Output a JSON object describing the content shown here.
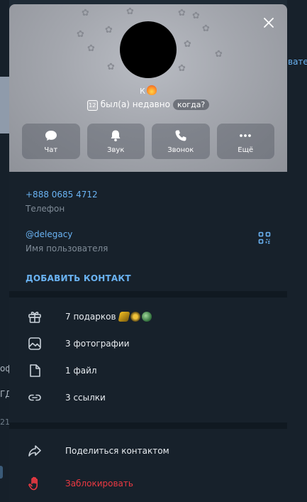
{
  "background": {
    "right_text": "вател",
    "left_texts": [
      "офо",
      "ГД",
      "21:"
    ]
  },
  "hero": {
    "name": "к",
    "last_seen_badge": "12",
    "status": "был(а) недавно",
    "when_chip": "когда?",
    "actions": [
      {
        "label": "Чат",
        "icon": "chat-icon"
      },
      {
        "label": "Звук",
        "icon": "bell-icon"
      },
      {
        "label": "Звонок",
        "icon": "phone-icon"
      },
      {
        "label": "Ещё",
        "icon": "more-icon"
      }
    ]
  },
  "info": {
    "phone": "+888 0685 4712",
    "phone_caption": "Телефон",
    "username": "@delegacy",
    "username_caption": "Имя пользователя",
    "add_contact": "ДОБАВИТЬ КОНТАКТ"
  },
  "media": [
    {
      "label": "7 подарков",
      "icon": "gift-icon"
    },
    {
      "label": "3 фотографии",
      "icon": "photo-icon"
    },
    {
      "label": "1 файл",
      "icon": "file-icon"
    },
    {
      "label": "3 ссылки",
      "icon": "link-icon"
    }
  ],
  "bottom": {
    "share": "Поделиться контактом",
    "block": "Заблокировать"
  },
  "colors": {
    "accent": "#6ab3f3",
    "danger": "#ec3942",
    "panel": "#17212b"
  }
}
